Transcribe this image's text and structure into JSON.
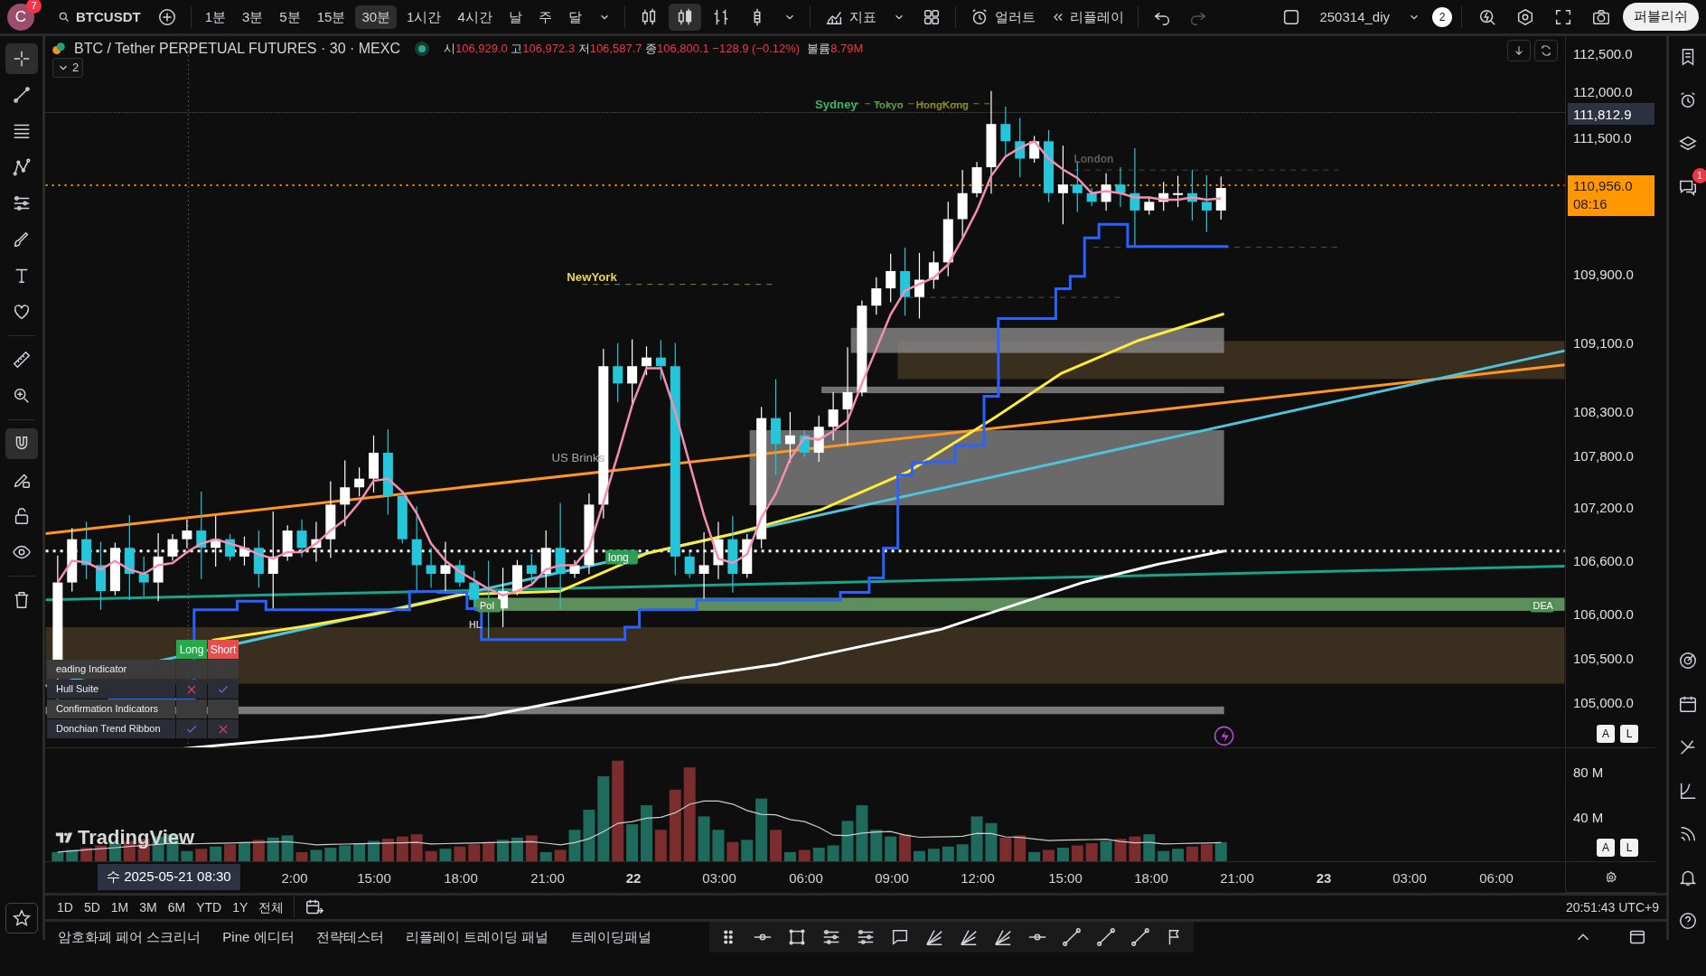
{
  "toolbar": {
    "avatar": "C",
    "notifications": "7",
    "symbol": "BTCUSDT",
    "intervals": [
      {
        "label": "1분",
        "selected": false
      },
      {
        "label": "3분",
        "selected": false
      },
      {
        "label": "5분",
        "selected": false
      },
      {
        "label": "15분",
        "selected": false
      },
      {
        "label": "30분",
        "selected": true
      },
      {
        "label": "1시간",
        "selected": false
      },
      {
        "label": "4시간",
        "selected": false
      },
      {
        "label": "날",
        "selected": false
      },
      {
        "label": "주",
        "selected": false
      },
      {
        "label": "달",
        "selected": false
      }
    ],
    "chart_types": [
      {
        "kind": "hollow",
        "selected": false
      },
      {
        "kind": "candles",
        "selected": true
      },
      {
        "kind": "bars",
        "selected": false
      },
      {
        "kind": "columns",
        "selected": false
      }
    ],
    "indicators_label": "지표",
    "alerts_label": "얼러트",
    "replay_label": "리플레이",
    "redo_disabled": true,
    "layout_name": "250314_diy",
    "layout_count": "2",
    "publish_label": "퍼블리쉬"
  },
  "legend": {
    "title": "BTC / Tether PERPETUAL FUTURES · 30 · MEXC",
    "ohlc": [
      {
        "label": "시",
        "value": "106,929.0"
      },
      {
        "label": "고",
        "value": "106,972.3"
      },
      {
        "label": "저",
        "value": "106,587.7"
      },
      {
        "label": "종",
        "value": "106,800.1"
      }
    ],
    "change": "−128.9 (−0.12%)",
    "volume_label": "볼륨",
    "volume": "8.79M",
    "collapsed_count": "2"
  },
  "chart_labels": [
    {
      "kind": "text",
      "text": "Sydney",
      "color": "#3bb36f"
    },
    {
      "kind": "text",
      "text": "Tokyo",
      "color": "#5d9a4c"
    },
    {
      "kind": "text",
      "text": "HongKong",
      "color": "#8c8a2e"
    },
    {
      "kind": "text",
      "text": "London",
      "color": "#5a5a5a"
    },
    {
      "kind": "text",
      "text": "NewYork",
      "color": "#e8d55a"
    },
    {
      "kind": "text",
      "text": "US Brinks",
      "color": "#a8a8a8"
    },
    {
      "kind": "tag",
      "text": "long",
      "color": "#2e9e55"
    },
    {
      "kind": "tag",
      "text": "PoI",
      "color": "#4e8f52"
    },
    {
      "kind": "text",
      "text": "HL",
      "color": "#bbbbbb"
    },
    {
      "kind": "tag",
      "text": "DEA",
      "color": "#4e8f52"
    }
  ],
  "signal_table": {
    "headers": [
      "Long",
      "Short"
    ],
    "rows": [
      {
        "kind": "section",
        "label": "eading Indicator"
      },
      {
        "kind": "signal",
        "label": "Hull Suite",
        "long": false,
        "short": true
      },
      {
        "kind": "section",
        "label": "Confirmation Indicators"
      },
      {
        "kind": "signal",
        "label": "Donchian Trend Ribbon",
        "long": true,
        "short": false
      }
    ]
  },
  "price_axis": {
    "labels": [
      "112,500.0",
      "112,000.0",
      "111,500.0",
      "109,900.0",
      "109,100.0",
      "108,300.0",
      "107,800.0",
      "107,200.0",
      "106,600.0",
      "106,000.0",
      "105,500.0",
      "105,000.0"
    ],
    "high_marker": "111,812.9",
    "last_price": "110,956.0",
    "countdown": "08:16",
    "scale_buttons": [
      "A",
      "L"
    ]
  },
  "volume_axis": {
    "labels": [
      "80 M",
      "40 M"
    ],
    "scale_buttons": [
      "A",
      "L"
    ]
  },
  "watermark": "TradingView",
  "time_axis": {
    "crosshair_label": "수 2025-05-21 08:30",
    "labels": [
      {
        "text": "2:00",
        "major": false
      },
      {
        "text": "15:00",
        "major": false
      },
      {
        "text": "18:00",
        "major": false
      },
      {
        "text": "21:00",
        "major": false
      },
      {
        "text": "22",
        "major": true
      },
      {
        "text": "03:00",
        "major": false
      },
      {
        "text": "06:00",
        "major": false
      },
      {
        "text": "09:00",
        "major": false
      },
      {
        "text": "12:00",
        "major": false
      },
      {
        "text": "15:00",
        "major": false
      },
      {
        "text": "18:00",
        "major": false
      },
      {
        "text": "21:00",
        "major": false
      },
      {
        "text": "23",
        "major": true
      },
      {
        "text": "03:00",
        "major": false
      },
      {
        "text": "06:00",
        "major": false
      }
    ]
  },
  "ranges": [
    "1D",
    "5D",
    "1M",
    "3M",
    "6M",
    "YTD",
    "1Y",
    "전체"
  ],
  "clock": "20:51:43 UTC+9",
  "bottom_tabs": [
    "암호화폐 페어 스크리너",
    "Pine 에디터",
    "전략테스터",
    "리플레이 트레이딩 패널",
    "트레이딩패널"
  ],
  "right_sidebar": {
    "chat_badge": "1"
  }
}
